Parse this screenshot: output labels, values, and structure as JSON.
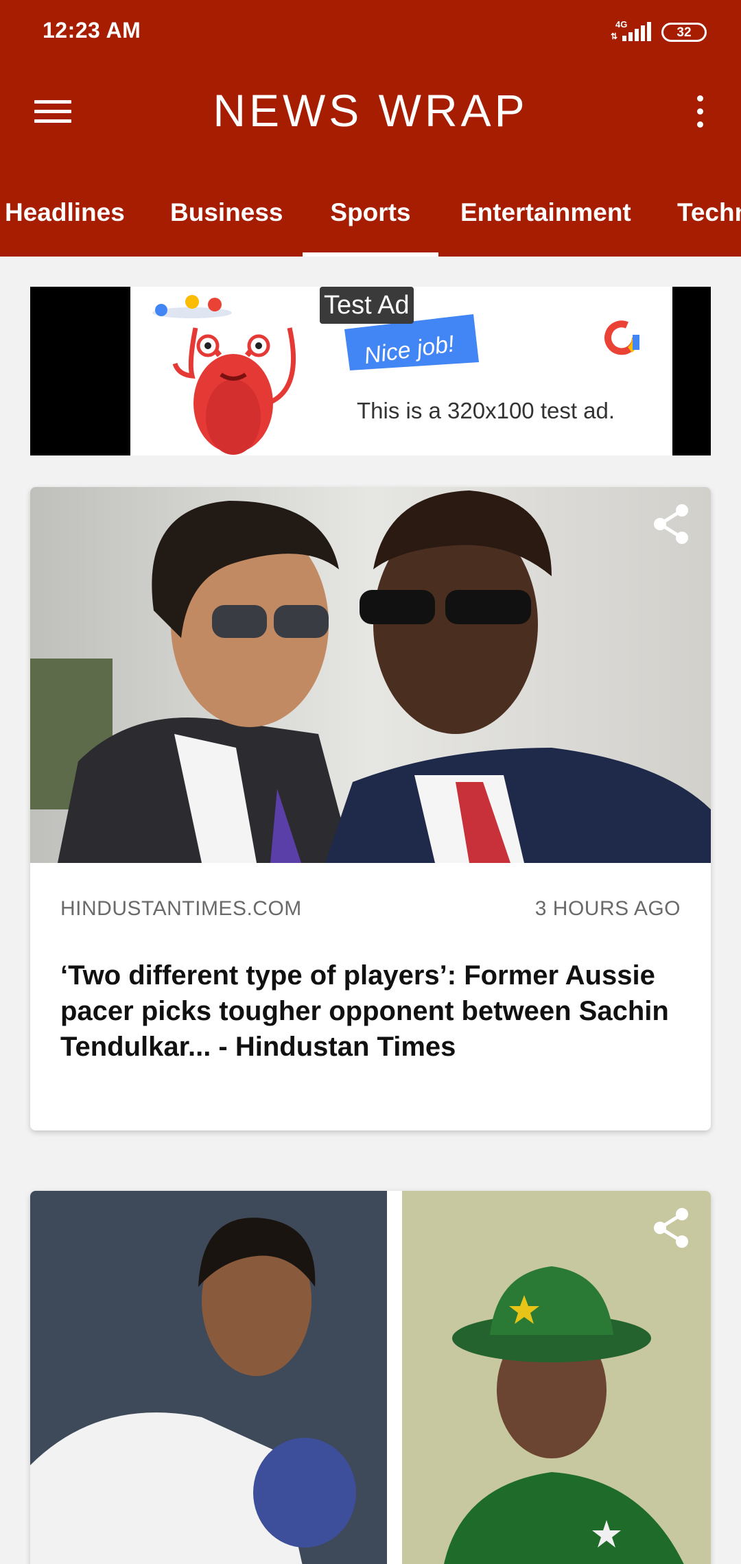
{
  "status_bar": {
    "time": "12:23 AM",
    "network": "4G",
    "battery": "32"
  },
  "app": {
    "title": "NEWS WRAP",
    "menu_icon": "hamburger-menu-icon",
    "overflow_icon": "more-vert-icon",
    "brand_color": "#a61d02"
  },
  "tabs": [
    {
      "label": "Headlines",
      "active": false
    },
    {
      "label": "Business",
      "active": false
    },
    {
      "label": "Sports",
      "active": true
    },
    {
      "label": "Entertainment",
      "active": false
    },
    {
      "label": "Techn",
      "active": false
    }
  ],
  "ad": {
    "label": "Test Ad",
    "badge": "Nice job!",
    "text": "This is a 320x100 test ad."
  },
  "articles": [
    {
      "source": "HINDUSTANTIMES.COM",
      "time": "3 HOURS AGO",
      "headline": "‘Two different type of players’: Former Aussie pacer picks tougher opponent between Sachin Tendulkar... - Hindustan Times",
      "share_icon": "share-icon"
    },
    {
      "share_icon": "share-icon"
    }
  ]
}
